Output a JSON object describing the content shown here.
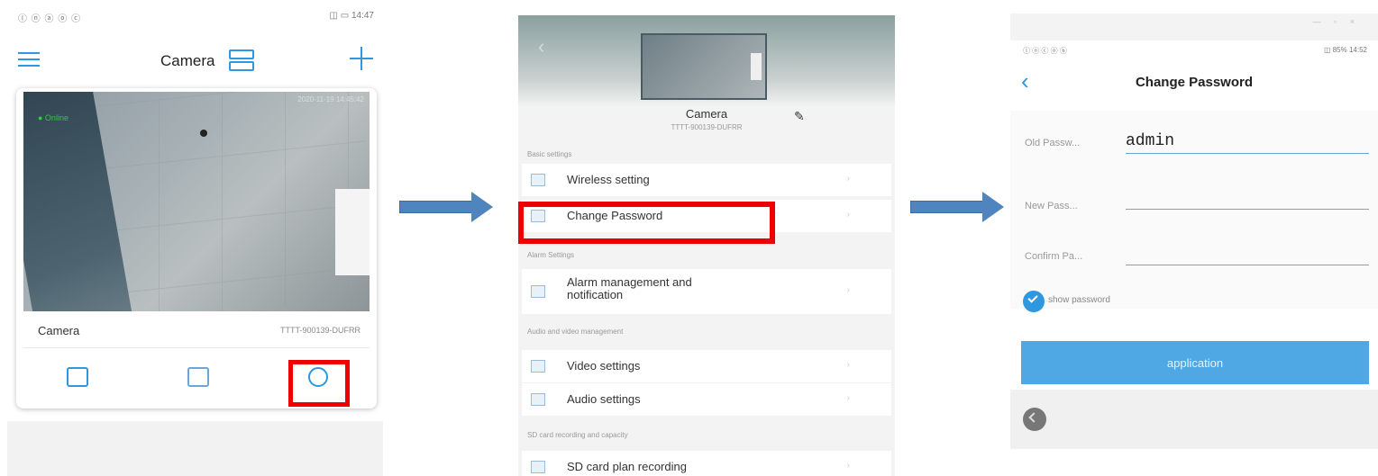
{
  "panel1": {
    "status_left": "ⓛ ⓝ ⓐ ⓞ ⓒ",
    "status_right": "◫ ▭ 14:47",
    "title": "Camera",
    "feed_timestamp": "2020-11-19 14:45:42",
    "feed_status": "● Online",
    "camera_name": "Camera",
    "camera_id": "TTTT-900139-DUFRR"
  },
  "panel2": {
    "camera_name": "Camera",
    "camera_id": "TTTT-900139-DUFRR",
    "sections": {
      "basic": "Basic settings",
      "alarm": "Alarm Settings",
      "av": "Audio and video management",
      "sd": "SD card recording and capacity"
    },
    "rows": {
      "wireless": "Wireless setting",
      "password": "Change Password",
      "alarm_1": "Alarm management and",
      "alarm_2": "notification",
      "video": "Video settings",
      "audio": "Audio settings",
      "sd": "SD card plan recording"
    },
    "chevron": "›"
  },
  "panel3": {
    "status_left": "ⓛ ⓝ ⓒ ⓞ ⓑ",
    "status_right": "◫ 85% 14:52",
    "window_controls": "— ▫ ×",
    "title": "Change Password",
    "old_label": "Old Passw...",
    "old_value": "admin",
    "new_label": "New Pass...",
    "confirm_label": "Confirm Pa...",
    "show_password": "show password",
    "apply_label": "application"
  },
  "colors": {
    "accent": "#2f97e0",
    "highlight": "#ee0000",
    "arrow": "#4f84bf",
    "button": "#4fa7e3"
  },
  "icons": {
    "menu": "hamburger-icon",
    "switch": "camera-switch-icon",
    "add": "plus-icon",
    "playback": "playback-icon",
    "sd": "sd-card-icon",
    "settings": "gear-icon",
    "edit": "pencil-icon",
    "back": "chevron-left-icon",
    "check": "check-icon"
  }
}
